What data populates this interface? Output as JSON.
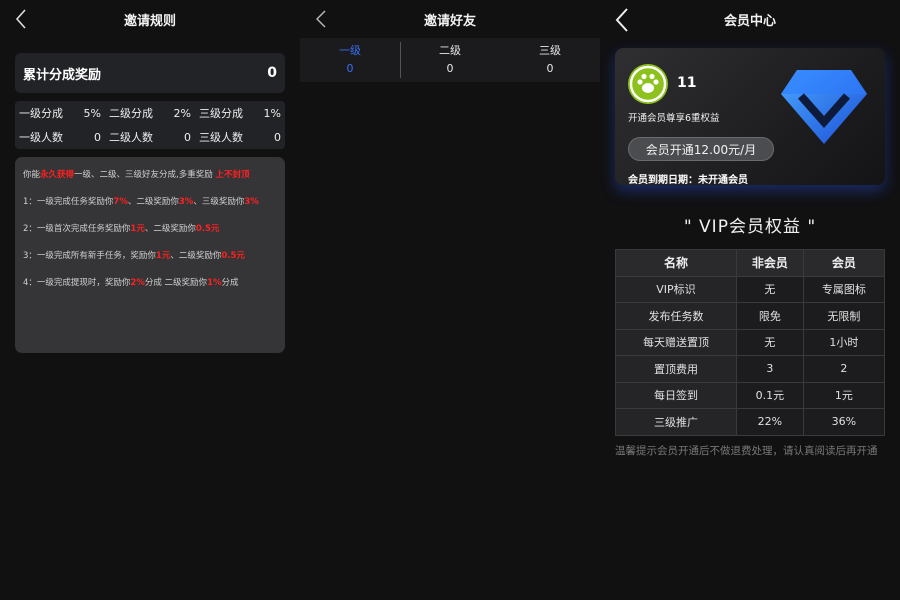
{
  "panel1": {
    "title": "邀请规则",
    "total_label": "累计分成奖励",
    "total_value": "0",
    "grid": [
      {
        "label": "一级分成",
        "value": "5%"
      },
      {
        "label": "二级分成",
        "value": "2%"
      },
      {
        "label": "三级分成",
        "value": "1%"
      },
      {
        "label": "一级人数",
        "value": "0"
      },
      {
        "label": "二级人数",
        "value": "0"
      },
      {
        "label": "三级人数",
        "value": "0"
      }
    ],
    "rules": {
      "intro_a": "你能",
      "intro_red1": "永久获得",
      "intro_b": "一级、二级、三级好友分成,多重奖励 ",
      "intro_red2": "上不封顶",
      "r1_a": "1：一级完成任务奖励你",
      "r1_v1": "7%",
      "r1_b": "、二级奖励你",
      "r1_v2": "3%",
      "r1_c": "、三级奖励你",
      "r1_v3": "3%",
      "r2_a": "2：一级首次完成任务奖励你",
      "r2_v1": "1元",
      "r2_b": "、二级奖励你",
      "r2_v2": "0.5元",
      "r3_a": "3：一级完成所有新手任务，奖励你",
      "r3_v1": "1元",
      "r3_b": "、二级奖励你",
      "r3_v2": "0.5元",
      "r4_a": "4：一级完成提现时，奖励你",
      "r4_v1": "2%",
      "r4_b": "分成 二级奖励你",
      "r4_v2": "1%",
      "r4_c": "分成"
    }
  },
  "panel2": {
    "title": "邀请好友",
    "tabs": [
      {
        "label": "一级",
        "count": "0"
      },
      {
        "label": "二级",
        "count": "0"
      },
      {
        "label": "三级",
        "count": "0"
      }
    ]
  },
  "panel3": {
    "title": "会员中心",
    "username": "11",
    "subtitle": "开通会员尊享6重权益",
    "open_button": "会员开通12.00元/月",
    "expire": "会员到期日期：未开通会员",
    "heading": "\" VIP会员权益 \"",
    "table": {
      "headers": [
        "名称",
        "非会员",
        "会员"
      ],
      "rows": [
        [
          "VIP标识",
          "无",
          "专属图标"
        ],
        [
          "发布任务数",
          "限免",
          "无限制"
        ],
        [
          "每天赠送置顶",
          "无",
          "1小时"
        ],
        [
          "置顶费用",
          "3",
          "2"
        ],
        [
          "每日签到",
          "0.1元",
          "1元"
        ],
        [
          "三级推广",
          "22%",
          "36%"
        ]
      ]
    },
    "tip": "温馨提示会员开通后不做退费处理，请认真阅读后再开通"
  },
  "colors": {
    "accent": "#3a6ff0",
    "highlight": "#ff2020",
    "avatar": "#8cc21b"
  }
}
